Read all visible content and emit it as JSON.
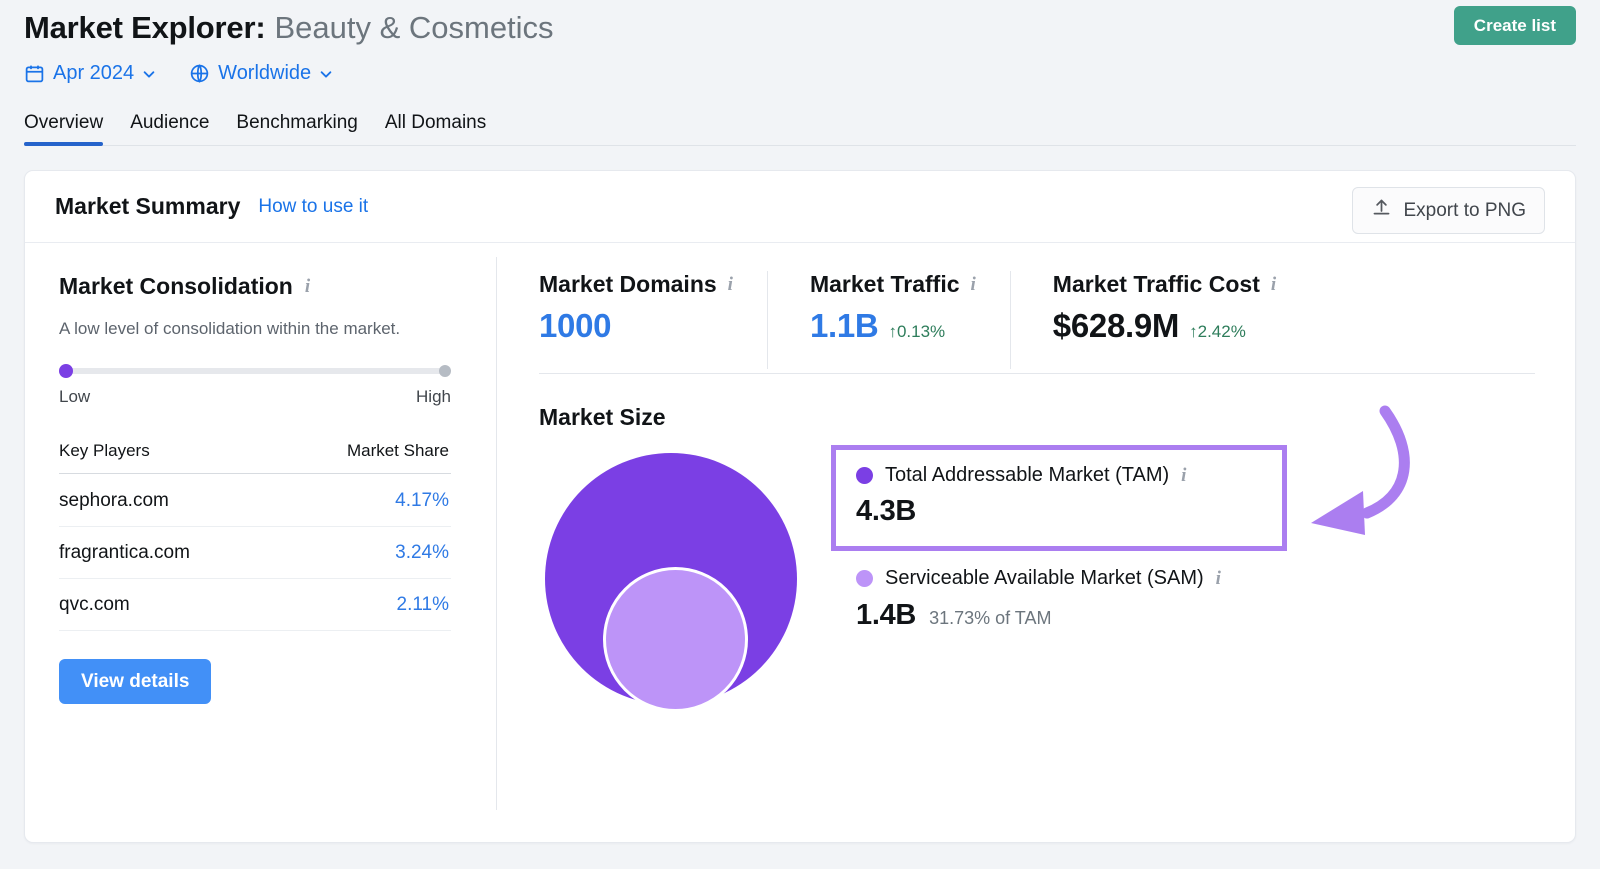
{
  "header": {
    "title_main": "Market Explorer:",
    "title_sub": "Beauty & Cosmetics",
    "create_list_label": "Create list",
    "filters": [
      {
        "icon": "calendar-icon",
        "label": "Apr 2024"
      },
      {
        "icon": "globe-icon",
        "label": "Worldwide"
      }
    ],
    "tabs": [
      {
        "label": "Overview",
        "active": true
      },
      {
        "label": "Audience",
        "active": false
      },
      {
        "label": "Benchmarking",
        "active": false
      },
      {
        "label": "All Domains",
        "active": false
      }
    ]
  },
  "card": {
    "title": "Market Summary",
    "how_to_use": "How to use it",
    "export_label": "Export to PNG"
  },
  "consolidation": {
    "title": "Market Consolidation",
    "info": "i",
    "description": "A low level of consolidation within the market.",
    "slider_low_label": "Low",
    "slider_high_label": "High",
    "slider_value_percent": 0,
    "table": {
      "col_player": "Key Players",
      "col_share": "Market Share",
      "rows": [
        {
          "domain": "sephora.com",
          "share": "4.17%"
        },
        {
          "domain": "fragrantica.com",
          "share": "3.24%"
        },
        {
          "domain": "qvc.com",
          "share": "2.11%"
        }
      ]
    },
    "view_details_label": "View details"
  },
  "metrics": [
    {
      "name": "Market Domains",
      "info": "i",
      "value": "1000",
      "delta": "",
      "value_color": "#2f7ae5"
    },
    {
      "name": "Market Traffic",
      "info": "i",
      "value": "1.1B",
      "delta": "↑0.13%",
      "value_color": "#2f7ae5"
    },
    {
      "name": "Market Traffic Cost",
      "info": "i",
      "value": "$628.9M",
      "delta": "↑2.42%",
      "value_color": "#111417"
    }
  ],
  "market_size": {
    "title": "Market Size",
    "tam": {
      "label": "Total Addressable Market (TAM)",
      "info": "i",
      "value": "4.3B",
      "note": "",
      "color": "#7b3fe4"
    },
    "sam": {
      "label": "Serviceable Available Market (SAM)",
      "info": "i",
      "value": "1.4B",
      "note": "31.73% of TAM",
      "color": "#bd94f8"
    }
  },
  "chart_data": {
    "type": "pie",
    "title": "Market Size",
    "categories": [
      "Total Addressable Market (TAM)",
      "Serviceable Available Market (SAM)"
    ],
    "values": [
      4.3,
      1.4
    ],
    "value_labels": [
      "4.3B",
      "1.4B"
    ],
    "colors": [
      "#7b3fe4",
      "#bd94f8"
    ],
    "annotations": [
      "31.73% of TAM"
    ],
    "legend": "right",
    "grid": false
  },
  "annotation": {
    "highlight_color": "#ab7ef0",
    "arrow_color": "#ab7ef0",
    "target": "Total Addressable Market (TAM)"
  },
  "colors": {
    "accent_green": "#40a18a",
    "accent_blue": "#4290f7",
    "link_blue": "#1a73e8",
    "purple_dark": "#7b3fe4",
    "purple_light": "#bd94f8",
    "positive_green": "#2e7d5b",
    "page_bg": "#f2f4f7"
  }
}
